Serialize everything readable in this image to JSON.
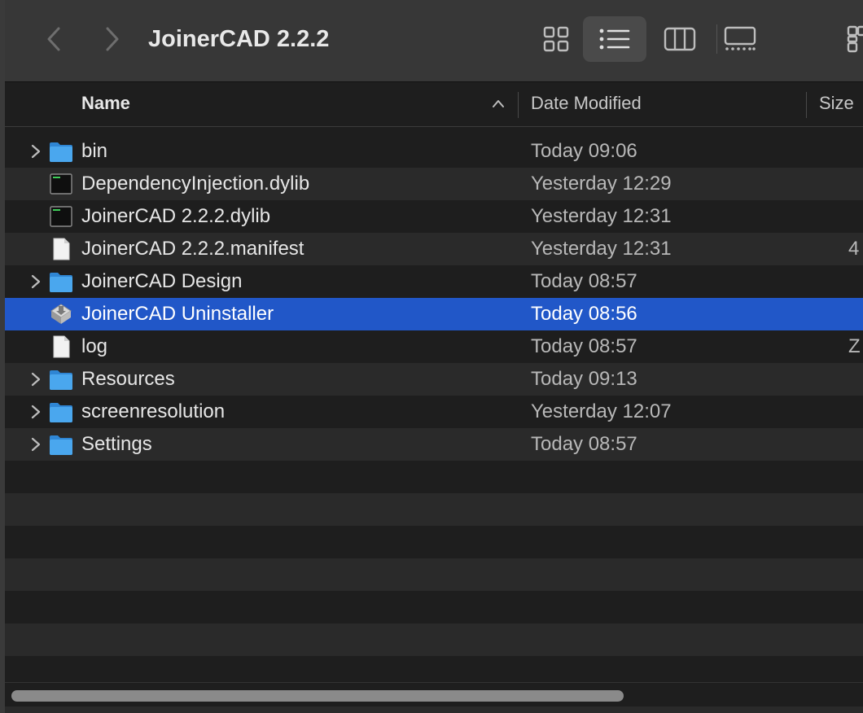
{
  "window": {
    "title": "JoinerCAD 2.2.2"
  },
  "toolbar": {
    "back_icon": "chevron-left-icon",
    "forward_icon": "chevron-right-icon",
    "views": [
      {
        "name": "icon-view",
        "icon": "grid-icon",
        "active": false
      },
      {
        "name": "list-view",
        "icon": "list-icon",
        "active": true
      },
      {
        "name": "column-view",
        "icon": "columns-icon",
        "active": false
      },
      {
        "name": "gallery-view",
        "icon": "gallery-icon",
        "active": false
      },
      {
        "name": "group",
        "icon": "group-icon",
        "active": false
      }
    ]
  },
  "columns": {
    "name": "Name",
    "date_modified": "Date Modified",
    "size": "Size",
    "sort": "ascending"
  },
  "files": [
    {
      "name": "bin",
      "kind": "folder",
      "date": "Today 09:06",
      "size": "",
      "expandable": true
    },
    {
      "name": "DependencyInjection.dylib",
      "kind": "exec",
      "date": "Yesterday 12:29",
      "size": "",
      "expandable": false
    },
    {
      "name": "JoinerCAD 2.2.2.dylib",
      "kind": "exec",
      "date": "Yesterday 12:31",
      "size": "",
      "expandable": false
    },
    {
      "name": "JoinerCAD 2.2.2.manifest",
      "kind": "document",
      "date": "Yesterday 12:31",
      "size": "4",
      "expandable": false
    },
    {
      "name": "JoinerCAD Design",
      "kind": "folder",
      "date": "Today 08:57",
      "size": "",
      "expandable": true
    },
    {
      "name": "JoinerCAD Uninstaller",
      "kind": "application",
      "date": "Today 08:56",
      "size": "",
      "expandable": false,
      "selected": true
    },
    {
      "name": "log",
      "kind": "document",
      "date": "Today 08:57",
      "size": "Z",
      "expandable": false
    },
    {
      "name": "Resources",
      "kind": "folder",
      "date": "Today 09:13",
      "size": "",
      "expandable": true
    },
    {
      "name": "screenresolution",
      "kind": "folder",
      "date": "Yesterday 12:07",
      "size": "",
      "expandable": true
    },
    {
      "name": "Settings",
      "kind": "folder",
      "date": "Today 08:57",
      "size": "",
      "expandable": true
    }
  ],
  "colors": {
    "selection": "#2157c8",
    "folder": "#3fa0e8"
  }
}
